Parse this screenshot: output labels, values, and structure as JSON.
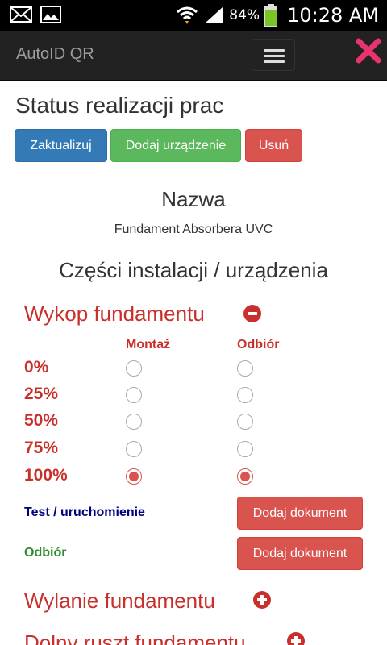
{
  "status_bar": {
    "battery": "84%",
    "time": "10:28 AM",
    "icons": [
      "mail-icon",
      "image-icon",
      "wifi-icon",
      "signal-icon",
      "battery-icon"
    ]
  },
  "navbar": {
    "brand": "AutoID QR",
    "menu_icon": "hamburger-menu-icon",
    "close_icon": "close-icon",
    "close_color": "#e8336d"
  },
  "page": {
    "title": "Status realizacji prac",
    "buttons": {
      "update": "Zaktualizuj",
      "add_device": "Dodaj urządzenie",
      "delete": "Usuń"
    },
    "name_heading": "Nazwa",
    "name_value": "Fundament Absorbera UVC",
    "parts_heading": "Części instalacji / urządzenia"
  },
  "sections": [
    {
      "title": "Wykop fundamentu",
      "expanded": true,
      "toggle_icon": "minus-circle-icon",
      "columns": [
        "Montaż",
        "Odbiór"
      ],
      "levels": [
        "0%",
        "25%",
        "50%",
        "75%",
        "100%"
      ],
      "selected": {
        "montaz": "100%",
        "odbior": "100%"
      },
      "test_label": "Test / uruchomienie",
      "receipt_label": "Odbiór",
      "add_document": "Dodaj dokument"
    },
    {
      "title": "Wylanie fundamentu",
      "expanded": false,
      "toggle_icon": "plus-circle-icon"
    },
    {
      "title": "Dolny ruszt fundamentu",
      "expanded": false,
      "toggle_icon": "plus-circle-icon"
    }
  ],
  "colors": {
    "primary": "#337ab7",
    "success": "#5cb85c",
    "danger": "#d9534f",
    "section_red": "#c9302c",
    "test_label": "#000080",
    "receipt_label": "#2e8b2e"
  }
}
